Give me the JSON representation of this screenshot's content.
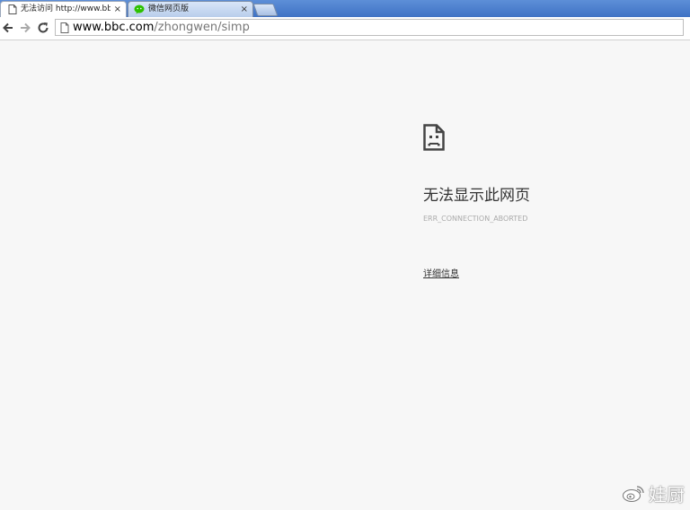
{
  "tabs": [
    {
      "title": "无法访问 http://www.bbc",
      "close": "×",
      "active": true,
      "icon": "page-icon"
    },
    {
      "title": "微信网页版",
      "close": "×",
      "active": false,
      "icon": "wechat-icon"
    }
  ],
  "toolbar": {
    "url_host": "www.bbc.com",
    "url_path": "/zhongwen/simp"
  },
  "error": {
    "title": "无法显示此网页",
    "code": "ERR_CONNECTION_ABORTED",
    "details_link": "详细信息"
  },
  "watermark": {
    "text": "娃厨",
    "logo": "weibo-logo"
  },
  "colors": {
    "tabstrip": "#3f72c4",
    "content_bg": "#f7f7f7",
    "wechat_green": "#2dc100"
  }
}
